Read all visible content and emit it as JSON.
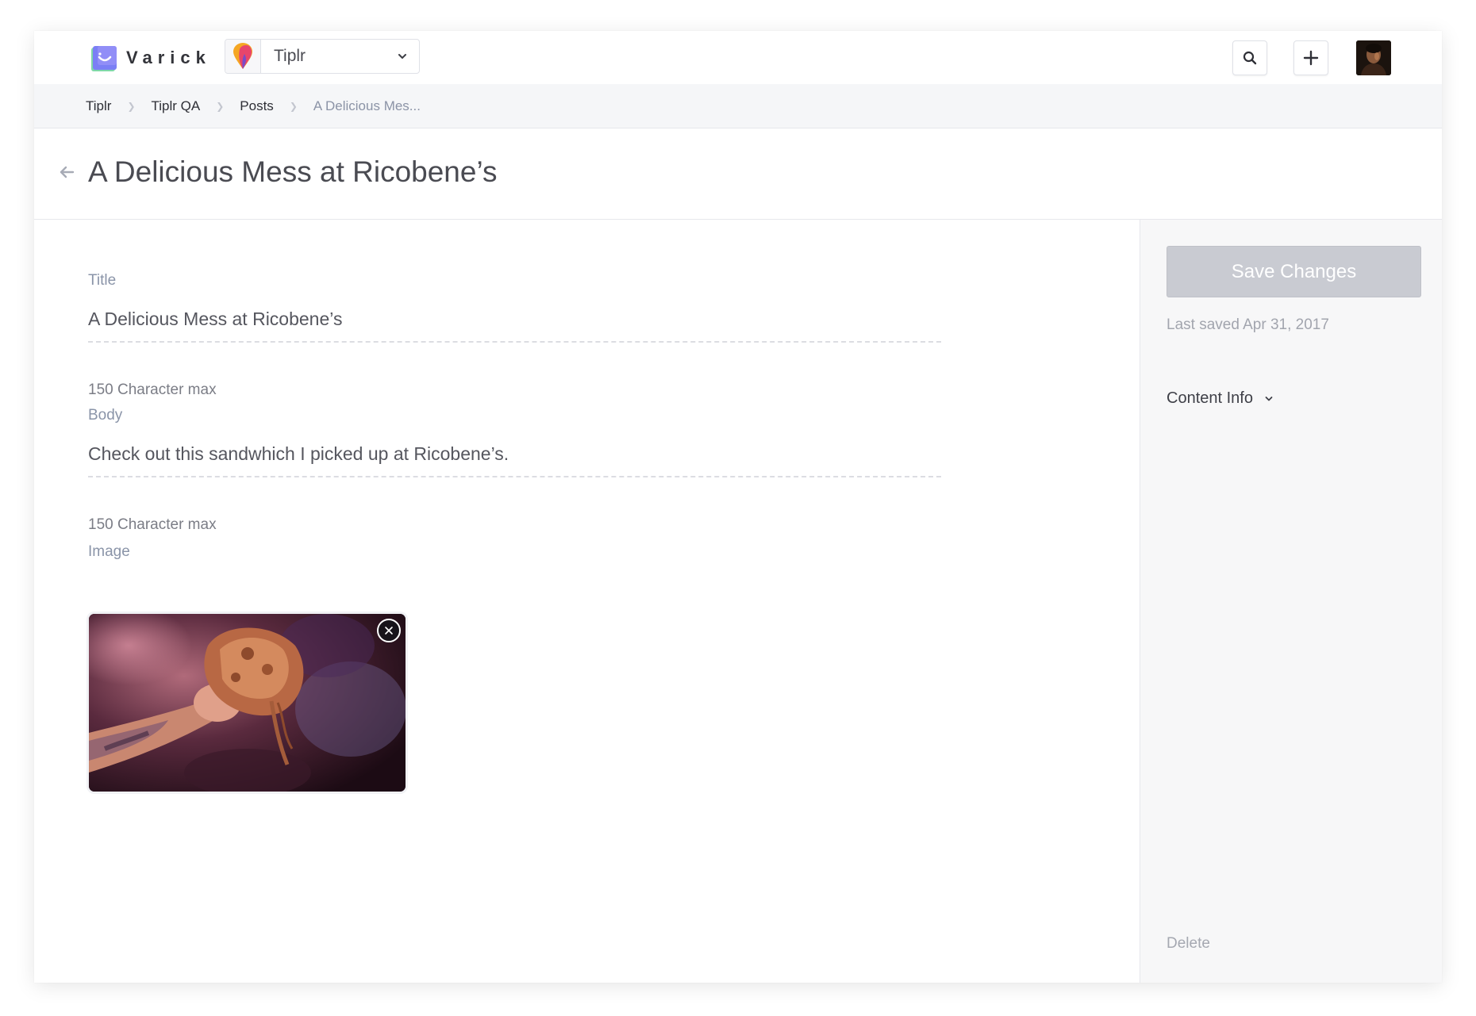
{
  "brand": {
    "name": "Varick",
    "accent": "#7b6cf6"
  },
  "app_selector": {
    "selected": "Tiplr"
  },
  "topnav": {
    "search_icon": "search-icon",
    "add_icon": "plus-icon"
  },
  "breadcrumb": {
    "items": [
      "Tiplr",
      "Tiplr QA",
      "Posts",
      "A Delicious Mes..."
    ]
  },
  "page": {
    "title": "A Delicious Mess at Ricobene’s"
  },
  "form": {
    "title_label": "Title",
    "title_value": "A Delicious Mess at Ricobene’s",
    "title_help": "150 Character max",
    "body_label": "Body",
    "body_value": "Check out this sandwhich I picked up at Ricobene’s.",
    "body_help": "150 Character max",
    "image_label": "Image"
  },
  "sidebar": {
    "save_label": "Save Changes",
    "last_saved": "Last saved Apr 31, 2017",
    "content_info_label": "Content Info",
    "delete_label": "Delete"
  }
}
